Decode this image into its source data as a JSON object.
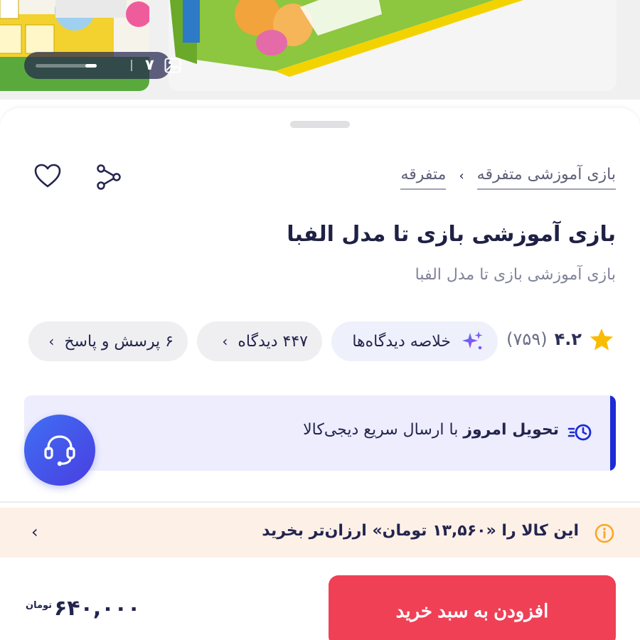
{
  "gallery": {
    "image_count": "۷",
    "scroll_position_fraction": 0.18
  },
  "breadcrumb": {
    "items": [
      "متفرقه",
      "بازی آموزشی متفرقه"
    ],
    "separator": "›"
  },
  "product": {
    "title": "بازی آموزشی بازی تا مدل الفبا",
    "subtitle": "بازی آموزشی بازی تا مدل الفبا"
  },
  "rating": {
    "score": "۴.۲",
    "count": "(۷۵۹)"
  },
  "chips": {
    "summary": "خلاصه دیدگاه‌ها",
    "reviews": "۴۴۷ دیدگاه",
    "qna": "۶ پرسش و پاسخ",
    "chevron": "›"
  },
  "delivery": {
    "bold": "تحویل امروز",
    "rest": "با ارسال سریع دیجی‌کالا"
  },
  "notice": {
    "text": "این کالا را «۱۳,۵۶۰ تومان» ارزان‌تر بخرید",
    "back": "‹"
  },
  "buy": {
    "button_label": "افزودن به سبد خرید",
    "price": "۶۴۰,۰۰۰",
    "currency": "تومان"
  },
  "colors": {
    "primary": "#ef4056",
    "delivery_accent": "#1c2bd6",
    "star": "#f9bc00",
    "support_gradient": [
      "#3f6ff4",
      "#4a3ee0"
    ],
    "notice_bg": "#fdf0e7",
    "info_icon": "#f9a825"
  },
  "icons": [
    "image-icon",
    "share-icon",
    "heart-icon",
    "star-icon",
    "sparkle-icon",
    "fast-delivery-icon",
    "headset-icon",
    "info-icon"
  ]
}
